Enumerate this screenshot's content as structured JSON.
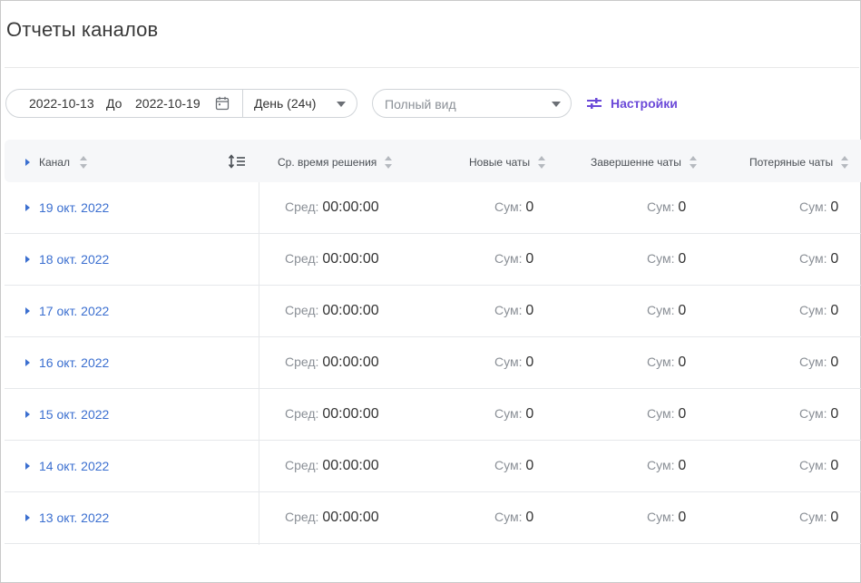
{
  "page": {
    "title": "Отчеты каналов"
  },
  "filters": {
    "date_from": "2022-10-13",
    "to_label": "До",
    "date_to": "2022-10-19",
    "period": "День (24ч)",
    "view_placeholder": "Полный вид",
    "settings_label": "Настройки"
  },
  "table": {
    "columns": [
      "Канал",
      "Ср. время решения",
      "Новые чаты",
      "Завершенне чаты",
      "Потеряные чаты"
    ],
    "avg_label": "Сред:",
    "sum_label": "Сум:",
    "rows": [
      {
        "date": "19 окт. 2022",
        "avg": "00:00:00",
        "new": "0",
        "done": "0",
        "lost": "0"
      },
      {
        "date": "18 окт. 2022",
        "avg": "00:00:00",
        "new": "0",
        "done": "0",
        "lost": "0"
      },
      {
        "date": "17 окт. 2022",
        "avg": "00:00:00",
        "new": "0",
        "done": "0",
        "lost": "0"
      },
      {
        "date": "16 окт. 2022",
        "avg": "00:00:00",
        "new": "0",
        "done": "0",
        "lost": "0"
      },
      {
        "date": "15 окт. 2022",
        "avg": "00:00:00",
        "new": "0",
        "done": "0",
        "lost": "0"
      },
      {
        "date": "14 окт. 2022",
        "avg": "00:00:00",
        "new": "0",
        "done": "0",
        "lost": "0"
      },
      {
        "date": "13 окт. 2022",
        "avg": "00:00:00",
        "new": "0",
        "done": "0",
        "lost": "0"
      }
    ]
  },
  "icons": {
    "calendar": "calendar-icon",
    "settings": "sliders-icon",
    "expand": "caret-right-icon",
    "sort": "sort-icon",
    "row_height": "line-height-icon"
  },
  "colors": {
    "accent": "#6b49d8",
    "link": "#3b6fd0"
  }
}
